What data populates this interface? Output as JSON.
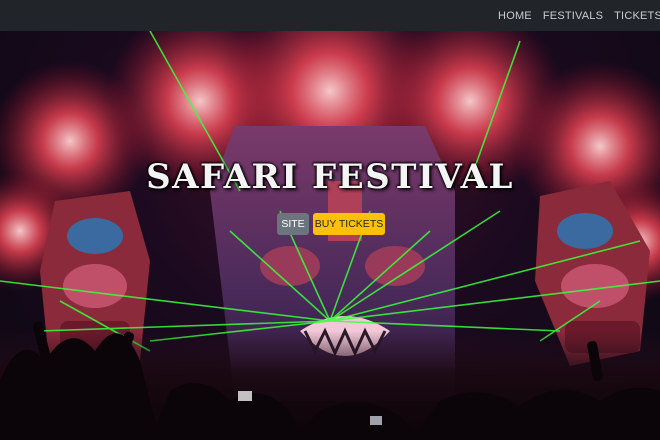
{
  "nav": {
    "items": [
      "HOME",
      "FESTIVALS",
      "TICKETS"
    ]
  },
  "hero": {
    "title": "SAFARI FESTIVAL",
    "site_button": "SITE",
    "buy_button": "BUY TICKETS"
  },
  "colors": {
    "navbar": "#212529",
    "site_button": "#6c757d",
    "buy_button": "#ffc107",
    "laser": "#39ff3a",
    "fireworks": "#ff4a5a"
  }
}
